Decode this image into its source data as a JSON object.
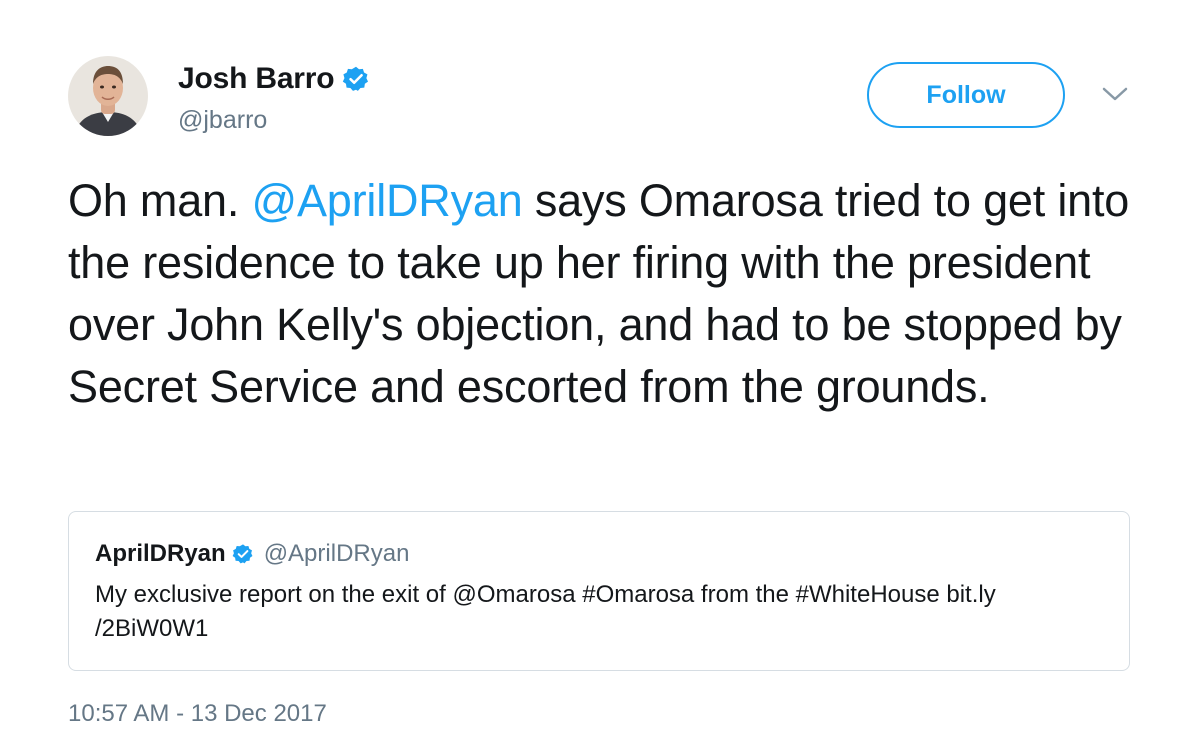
{
  "author": {
    "name": "Josh Barro",
    "handle": "@jbarro",
    "verified_icon": "verified-badge-icon"
  },
  "follow_button": {
    "label": "Follow"
  },
  "menu": {
    "icon": "chevron-down-icon"
  },
  "tweet": {
    "text_before": "Oh man. ",
    "mention": "@AprilDRyan",
    "text_after": " says Omarosa tried to get into the residence to take up her firing with the president over John Kelly's objection, and had to be stopped by Secret Service and escorted from the grounds."
  },
  "quoted_tweet": {
    "name": "AprilDRyan",
    "handle": "@AprilDRyan",
    "text": "My exclusive report on the exit of @Omarosa #Omarosa from the #WhiteHouse bit.ly /2BiW0W1"
  },
  "timestamp": "10:57 AM - 13 Dec 2017",
  "colors": {
    "accent": "#1da1f2",
    "text": "#14171a",
    "muted": "#657786",
    "border": "#d6dde3"
  }
}
